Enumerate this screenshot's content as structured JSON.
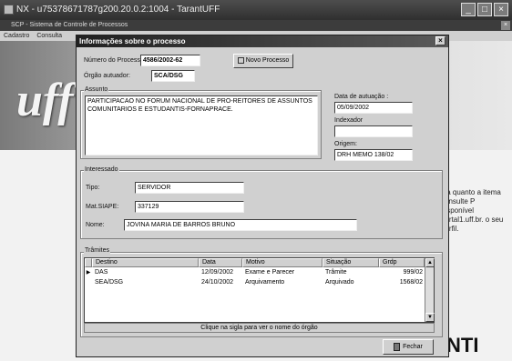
{
  "nx_window": {
    "title": "NX - u75378671787g200.20.0.2:1004 - TarantUFF",
    "buttons": [
      "_",
      "□",
      "×"
    ]
  },
  "background_app": {
    "title": "SCP - Sistema de Controle de Processos",
    "menu": [
      "Cadastro",
      "Consulta"
    ],
    "side_text": "ida quanto a itema consulte P disponível portal1.uff.br. o seu perfil.",
    "footer_logo": "NTI"
  },
  "dialog": {
    "title": "Informações sobre o processo",
    "close": "×",
    "numero_label": "Número do Processo:",
    "numero_value": "4586/2002-62",
    "novo_processo_button": "Novo Processo",
    "orgao_label": "Órgão autuador:",
    "orgao_value": "SCA/DSG",
    "assunto_caption": "Assunto",
    "assunto_text": "PARTICIPACAO NO FORUM NACIONAL DE PRO-REITORES DE ASSUNTOS COMUNITARIOS E ESTUDANTIS-FORNAPRACE.",
    "data_autuacao_label": "Data de autuação :",
    "data_autuacao_value": "05/09/2002",
    "indexador_label": "Indexador",
    "indexador_value": "",
    "origem_label": "Origem:",
    "origem_value": "DRH MEMO 138/02",
    "interessado_caption": "Interessado",
    "tipo_label": "Tipo:",
    "tipo_value": "SERVIDOR",
    "siape_label": "Mat.SIAPE:",
    "siape_value": "337129",
    "nome_label": "Nome:",
    "nome_value": "JOVINA MARIA DE BARROS BRUNO",
    "tramites_caption": "Trâmites",
    "table": {
      "headers": [
        "Destino",
        "Data",
        "Motivo",
        "Situação",
        "Grdp"
      ],
      "rows": [
        {
          "marker": "▶",
          "destino": "DAS",
          "data": "12/09/2002",
          "motivo": "Exame e Parecer",
          "situacao": "Trâmite",
          "grdp": "999/02"
        },
        {
          "marker": "",
          "destino": "SEA/DSG",
          "data": "24/10/2002",
          "motivo": "Arquivamento",
          "situacao": "Arquivado",
          "grdp": "1568/02"
        }
      ]
    },
    "hint": "Clique na sigla para ver o nome do órgão",
    "fechar_button": "Fechar"
  }
}
